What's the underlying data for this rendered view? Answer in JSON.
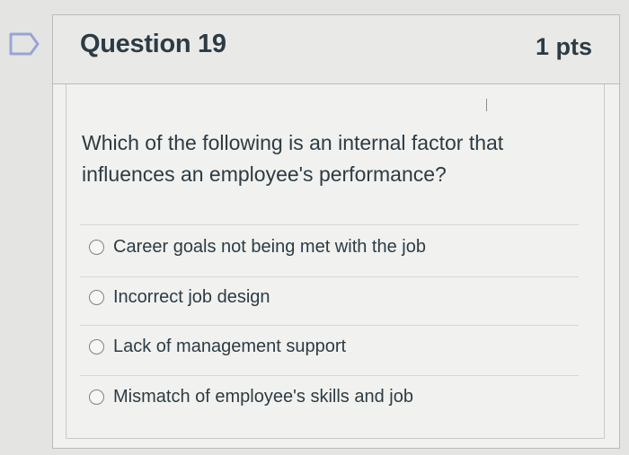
{
  "question": {
    "title": "Question 19",
    "points": "1 pts",
    "text": "Which of the following is an internal factor that influences an employee's performance?"
  },
  "answers": [
    {
      "label": "Career goals not being met with the job"
    },
    {
      "label": "Incorrect job design"
    },
    {
      "label": "Lack of management support"
    },
    {
      "label": "Mismatch of employee's skills and job"
    }
  ],
  "flag_icon": "bookmark-flag-icon",
  "colors": {
    "accent": "#2d3b45",
    "flag": "#9aa3d8",
    "card_bg": "#f1f2ef"
  }
}
